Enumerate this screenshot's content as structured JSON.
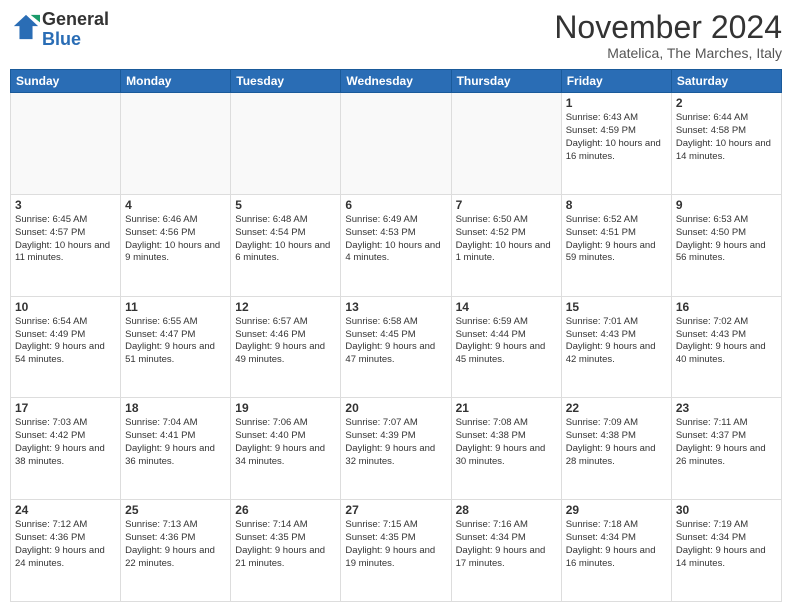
{
  "logo": {
    "general": "General",
    "blue": "Blue"
  },
  "title": "November 2024",
  "subtitle": "Matelica, The Marches, Italy",
  "days_of_week": [
    "Sunday",
    "Monday",
    "Tuesday",
    "Wednesday",
    "Thursday",
    "Friday",
    "Saturday"
  ],
  "weeks": [
    [
      {
        "day": "",
        "info": ""
      },
      {
        "day": "",
        "info": ""
      },
      {
        "day": "",
        "info": ""
      },
      {
        "day": "",
        "info": ""
      },
      {
        "day": "",
        "info": ""
      },
      {
        "day": "1",
        "info": "Sunrise: 6:43 AM\nSunset: 4:59 PM\nDaylight: 10 hours and 16 minutes."
      },
      {
        "day": "2",
        "info": "Sunrise: 6:44 AM\nSunset: 4:58 PM\nDaylight: 10 hours and 14 minutes."
      }
    ],
    [
      {
        "day": "3",
        "info": "Sunrise: 6:45 AM\nSunset: 4:57 PM\nDaylight: 10 hours and 11 minutes."
      },
      {
        "day": "4",
        "info": "Sunrise: 6:46 AM\nSunset: 4:56 PM\nDaylight: 10 hours and 9 minutes."
      },
      {
        "day": "5",
        "info": "Sunrise: 6:48 AM\nSunset: 4:54 PM\nDaylight: 10 hours and 6 minutes."
      },
      {
        "day": "6",
        "info": "Sunrise: 6:49 AM\nSunset: 4:53 PM\nDaylight: 10 hours and 4 minutes."
      },
      {
        "day": "7",
        "info": "Sunrise: 6:50 AM\nSunset: 4:52 PM\nDaylight: 10 hours and 1 minute."
      },
      {
        "day": "8",
        "info": "Sunrise: 6:52 AM\nSunset: 4:51 PM\nDaylight: 9 hours and 59 minutes."
      },
      {
        "day": "9",
        "info": "Sunrise: 6:53 AM\nSunset: 4:50 PM\nDaylight: 9 hours and 56 minutes."
      }
    ],
    [
      {
        "day": "10",
        "info": "Sunrise: 6:54 AM\nSunset: 4:49 PM\nDaylight: 9 hours and 54 minutes."
      },
      {
        "day": "11",
        "info": "Sunrise: 6:55 AM\nSunset: 4:47 PM\nDaylight: 9 hours and 51 minutes."
      },
      {
        "day": "12",
        "info": "Sunrise: 6:57 AM\nSunset: 4:46 PM\nDaylight: 9 hours and 49 minutes."
      },
      {
        "day": "13",
        "info": "Sunrise: 6:58 AM\nSunset: 4:45 PM\nDaylight: 9 hours and 47 minutes."
      },
      {
        "day": "14",
        "info": "Sunrise: 6:59 AM\nSunset: 4:44 PM\nDaylight: 9 hours and 45 minutes."
      },
      {
        "day": "15",
        "info": "Sunrise: 7:01 AM\nSunset: 4:43 PM\nDaylight: 9 hours and 42 minutes."
      },
      {
        "day": "16",
        "info": "Sunrise: 7:02 AM\nSunset: 4:43 PM\nDaylight: 9 hours and 40 minutes."
      }
    ],
    [
      {
        "day": "17",
        "info": "Sunrise: 7:03 AM\nSunset: 4:42 PM\nDaylight: 9 hours and 38 minutes."
      },
      {
        "day": "18",
        "info": "Sunrise: 7:04 AM\nSunset: 4:41 PM\nDaylight: 9 hours and 36 minutes."
      },
      {
        "day": "19",
        "info": "Sunrise: 7:06 AM\nSunset: 4:40 PM\nDaylight: 9 hours and 34 minutes."
      },
      {
        "day": "20",
        "info": "Sunrise: 7:07 AM\nSunset: 4:39 PM\nDaylight: 9 hours and 32 minutes."
      },
      {
        "day": "21",
        "info": "Sunrise: 7:08 AM\nSunset: 4:38 PM\nDaylight: 9 hours and 30 minutes."
      },
      {
        "day": "22",
        "info": "Sunrise: 7:09 AM\nSunset: 4:38 PM\nDaylight: 9 hours and 28 minutes."
      },
      {
        "day": "23",
        "info": "Sunrise: 7:11 AM\nSunset: 4:37 PM\nDaylight: 9 hours and 26 minutes."
      }
    ],
    [
      {
        "day": "24",
        "info": "Sunrise: 7:12 AM\nSunset: 4:36 PM\nDaylight: 9 hours and 24 minutes."
      },
      {
        "day": "25",
        "info": "Sunrise: 7:13 AM\nSunset: 4:36 PM\nDaylight: 9 hours and 22 minutes."
      },
      {
        "day": "26",
        "info": "Sunrise: 7:14 AM\nSunset: 4:35 PM\nDaylight: 9 hours and 21 minutes."
      },
      {
        "day": "27",
        "info": "Sunrise: 7:15 AM\nSunset: 4:35 PM\nDaylight: 9 hours and 19 minutes."
      },
      {
        "day": "28",
        "info": "Sunrise: 7:16 AM\nSunset: 4:34 PM\nDaylight: 9 hours and 17 minutes."
      },
      {
        "day": "29",
        "info": "Sunrise: 7:18 AM\nSunset: 4:34 PM\nDaylight: 9 hours and 16 minutes."
      },
      {
        "day": "30",
        "info": "Sunrise: 7:19 AM\nSunset: 4:34 PM\nDaylight: 9 hours and 14 minutes."
      }
    ]
  ]
}
